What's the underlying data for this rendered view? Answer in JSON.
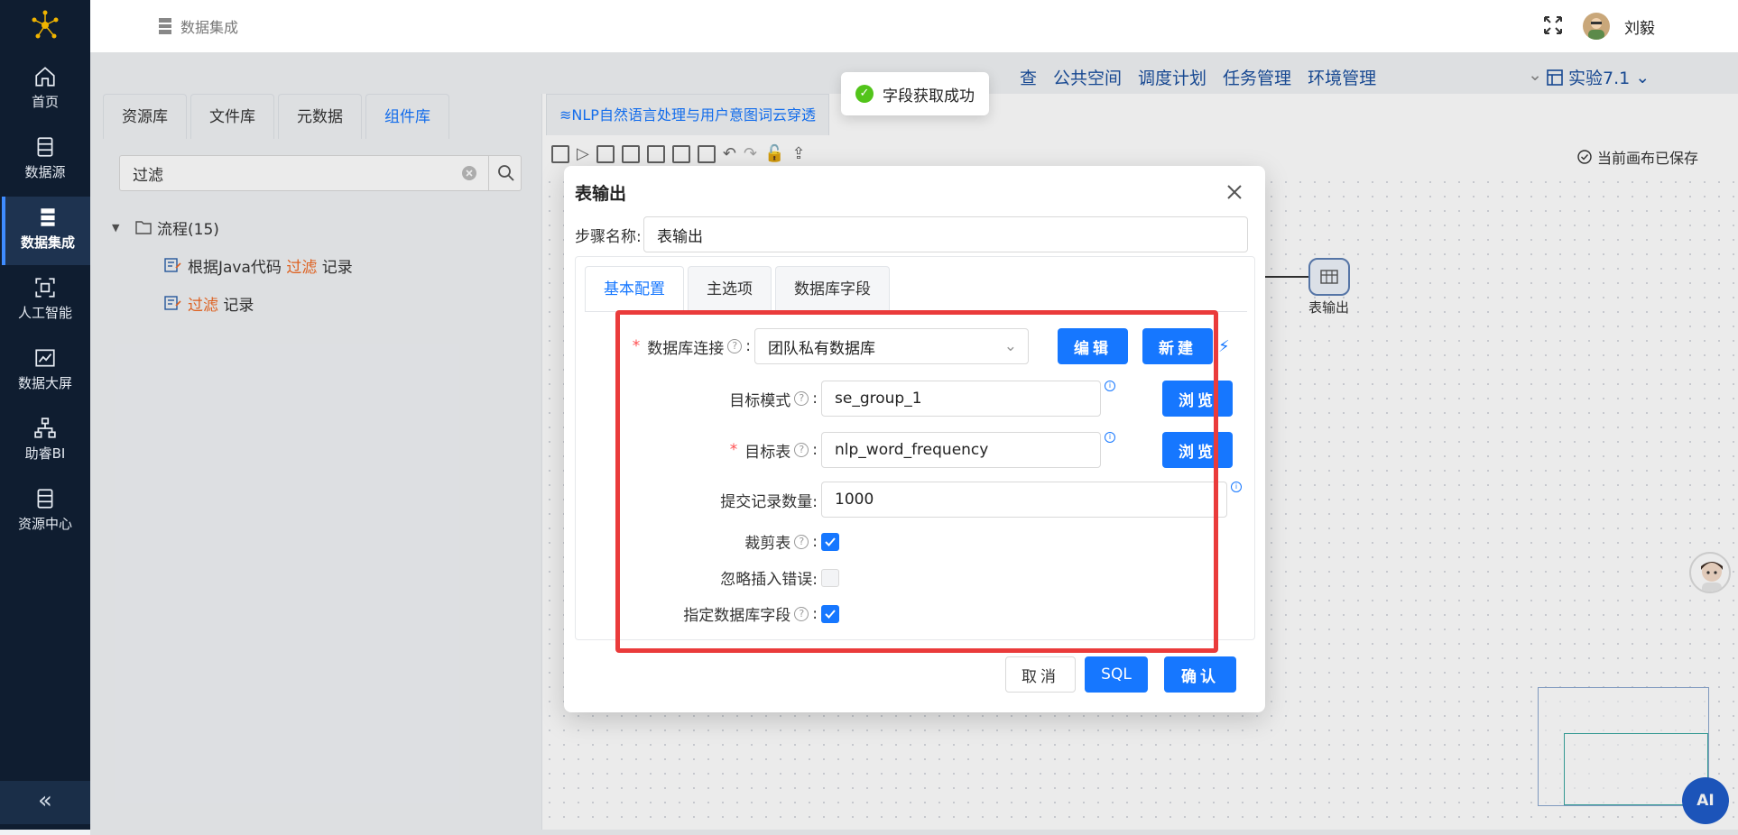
{
  "nav": {
    "items": [
      {
        "label": "首页",
        "icon": "home-icon"
      },
      {
        "label": "数据源",
        "icon": "datasource-icon"
      },
      {
        "label": "数据集成",
        "icon": "server-icon",
        "active": true
      },
      {
        "label": "人工智能",
        "icon": "ai-scan-icon"
      },
      {
        "label": "数据大屏",
        "icon": "chart-line-icon"
      },
      {
        "label": "助睿BI",
        "icon": "org-chart-icon"
      },
      {
        "label": "资源中心",
        "icon": "resource-icon"
      }
    ],
    "collapse": "«"
  },
  "header": {
    "breadcrumb": "数据集成",
    "username": "刘毅"
  },
  "library": {
    "tabs": [
      "资源库",
      "文件库",
      "元数据",
      "组件库"
    ],
    "active_tab": "组件库",
    "search_value": "过滤",
    "tree": {
      "root": "流程(15)",
      "children": [
        {
          "pre": "根据Java代码 ",
          "hl": "过滤",
          "post": " 记录"
        },
        {
          "pre": "",
          "hl": "过滤",
          "post": " 记录"
        }
      ]
    }
  },
  "canvas": {
    "tab_title": "NLP自然语言处理与用户意图词云穿透",
    "saved_text": "当前画布已保存",
    "top_nav": [
      "公共空间",
      "调度计划",
      "任务管理",
      "环境管理"
    ],
    "top_nav_partial": "查",
    "project": "实验7.1",
    "node_label": "表输出"
  },
  "toast": {
    "text": "字段获取成功"
  },
  "modal": {
    "title": "表输出",
    "step_label": "步骤名称:",
    "step_value": "表输出",
    "tabs": [
      "基本配置",
      "主选项",
      "数据库字段"
    ],
    "active_tab": "基本配置",
    "fields": {
      "db_conn": {
        "label": "数据库连接",
        "value": "团队私有数据库",
        "edit": "编辑",
        "new": "新建"
      },
      "schema": {
        "label": "目标模式",
        "value": "se_group_1",
        "browse": "浏览"
      },
      "table": {
        "label": "目标表",
        "value": "nlp_word_frequency",
        "browse": "浏览"
      },
      "commit": {
        "label": "提交记录数量:",
        "value": "1000"
      },
      "truncate": {
        "label": "裁剪表",
        "checked": true
      },
      "ignore_errors": {
        "label": "忽略插入错误:",
        "checked": false
      },
      "specify_fields": {
        "label": "指定数据库字段",
        "checked": true
      }
    },
    "buttons": {
      "cancel": "取消",
      "sql": "SQL",
      "ok": "确认"
    }
  },
  "ai_button": "AI",
  "colors": {
    "accent": "#1677ff",
    "nav_bg": "#0f1d30",
    "highlight": "#f06a24",
    "annotation": "#ea3b3b"
  }
}
